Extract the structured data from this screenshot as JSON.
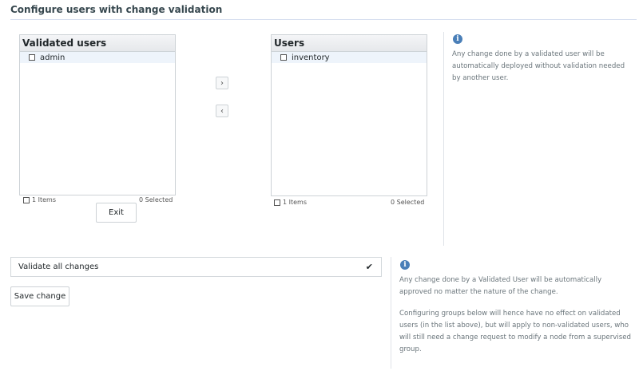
{
  "page": {
    "title": "Configure users with change validation"
  },
  "validated": {
    "header": "Validated users",
    "items": [
      "admin"
    ],
    "count": "1 Items",
    "selected": "0 Selected"
  },
  "users": {
    "header": "Users",
    "items": [
      "inventory"
    ],
    "count": "1 Items",
    "selected": "0 Selected"
  },
  "buttons": {
    "move_right": "›",
    "move_left": "‹",
    "exit": "Exit",
    "save": "Save change"
  },
  "info_top": {
    "text": "Any change done by a validated user will be automatically deployed without validation needed by another user."
  },
  "validate_all": {
    "label": "Validate all changes",
    "checkmark": "✔"
  },
  "info_bottom": {
    "p1": "Any change done by a Validated User will be automatically approved no matter the nature of the change.",
    "p2": "Configuring groups below will hence have no effect on validated users (in the list above), but will apply to non-validated users, who will still need a change request to modify a node from a supervised group."
  },
  "icons": {
    "info": "info-icon"
  }
}
